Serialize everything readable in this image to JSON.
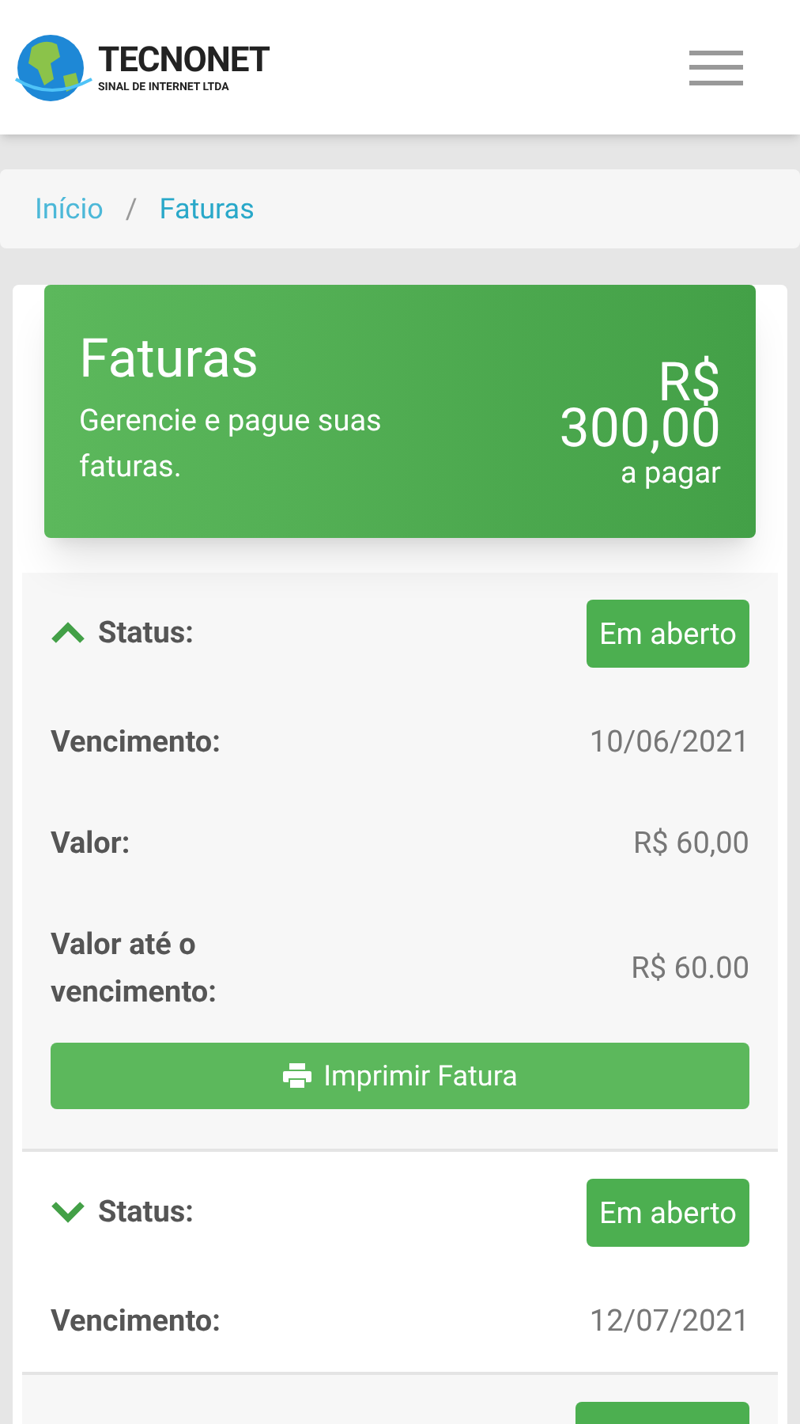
{
  "header": {
    "brand": "TECNONET",
    "tagline": "SINAL DE INTERNET LTDA"
  },
  "breadcrumb": [
    {
      "label": "Início",
      "selected": false
    },
    {
      "separator": "/",
      "label": "Faturas",
      "selected": true
    }
  ],
  "summary": {
    "title": "Faturas",
    "subtitle": "Gerencie e pague suas faturas.",
    "currency": "R$",
    "amount": "300,00",
    "caption": "a pagar"
  },
  "invoices": [
    {
      "expanded": true,
      "status_label": "Status:",
      "status": "Em aberto",
      "fields": [
        {
          "label": "Vencimento:",
          "value": "10/06/2021"
        },
        {
          "label": "Valor:",
          "value": "R$ 60,00"
        },
        {
          "label": "Valor até o vencimento:",
          "value": "R$ 60.00"
        }
      ],
      "print_button": "Imprimir Fatura"
    },
    {
      "expanded": false,
      "status_label": "Status:",
      "status": "Em aberto",
      "fields": [
        {
          "label": "Vencimento:",
          "value": "12/07/2021"
        }
      ]
    },
    {
      "badge": true
    }
  ]
}
